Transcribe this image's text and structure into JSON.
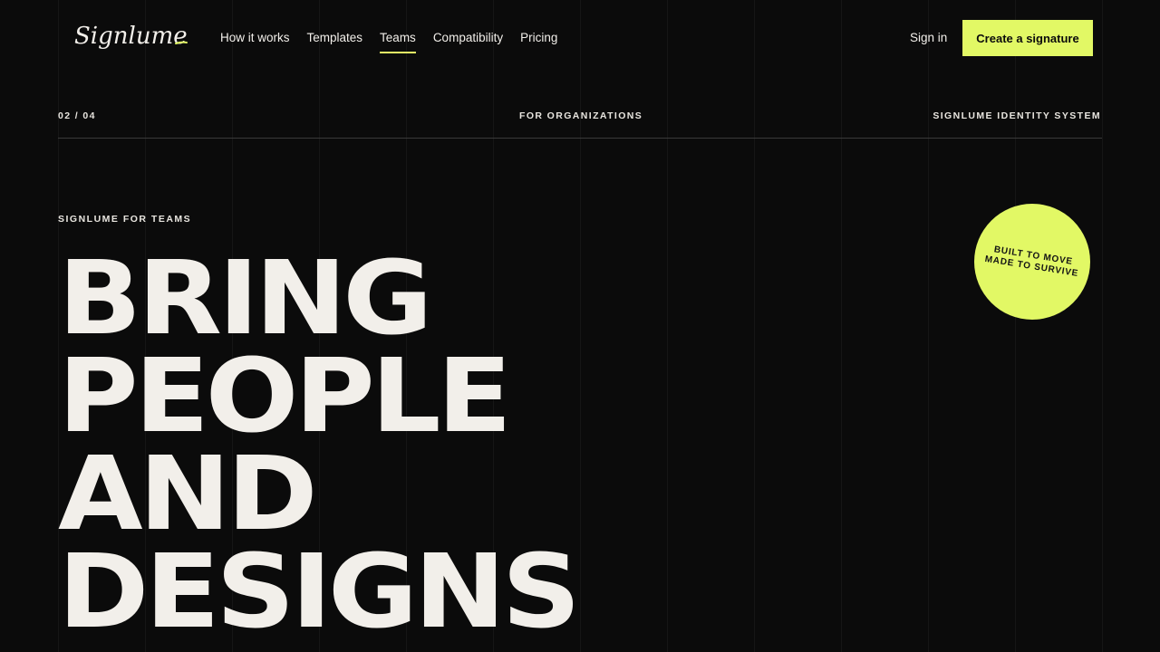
{
  "brand": {
    "name": "Signlume",
    "accent_color": "#e2f865",
    "background_color": "#0b0b0b"
  },
  "nav": {
    "items": [
      {
        "label": "How it works",
        "active": false
      },
      {
        "label": "Templates",
        "active": false
      },
      {
        "label": "Teams",
        "active": true
      },
      {
        "label": "Compatibility",
        "active": false
      },
      {
        "label": "Pricing",
        "active": false
      }
    ],
    "signin_label": "Sign in",
    "cta_label": "Create a signature"
  },
  "meta": {
    "page_counter": "02 / 04",
    "section": "FOR ORGANIZATIONS",
    "system_label": "SIGNLUME IDENTITY SYSTEM"
  },
  "hero": {
    "eyebrow": "SIGNLUME FOR TEAMS",
    "headline_lines": [
      "BRING",
      "PEOPLE",
      "AND",
      "DESIGNS"
    ],
    "badge_line1": "BUILT TO MOVE",
    "badge_line2": "MADE TO SURVIVE"
  }
}
